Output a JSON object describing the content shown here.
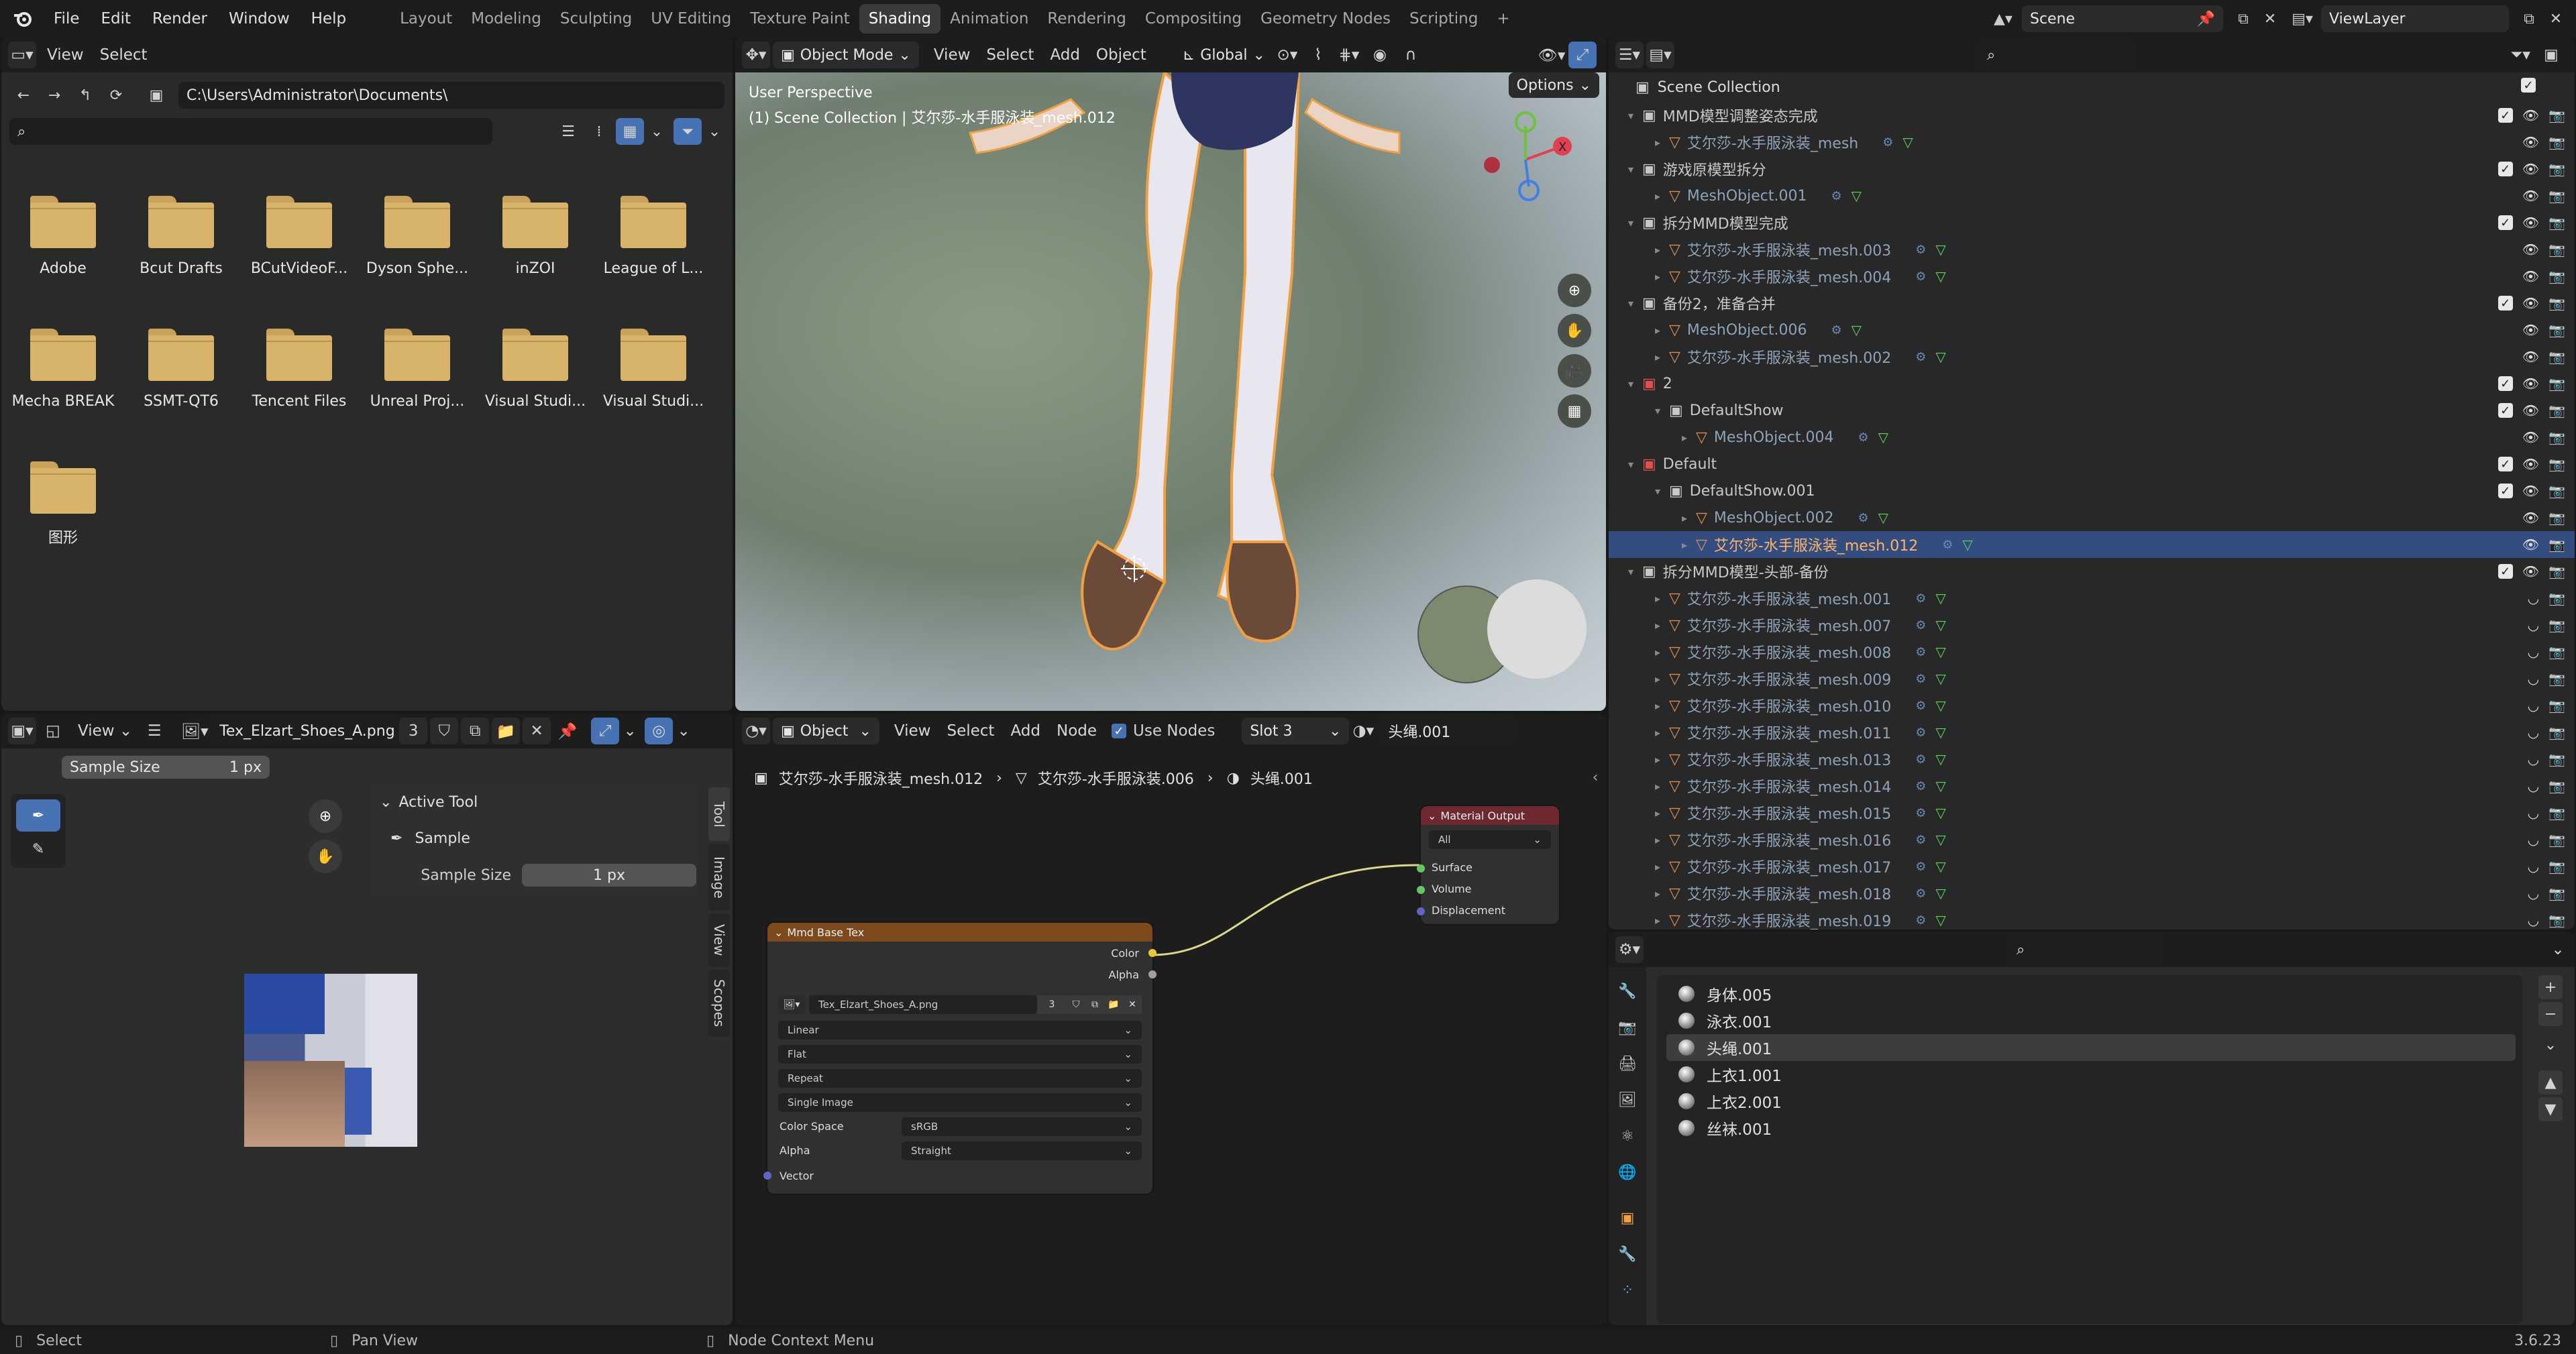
{
  "topbar": {
    "menus": [
      "File",
      "Edit",
      "Render",
      "Window",
      "Help"
    ],
    "workspaces": [
      "Layout",
      "Modeling",
      "Sculpting",
      "UV Editing",
      "Texture Paint",
      "Shading",
      "Animation",
      "Rendering",
      "Compositing",
      "Geometry Nodes",
      "Scripting"
    ],
    "active_workspace": "Shading",
    "add_tab": "+",
    "scene": "Scene",
    "viewlayer": "ViewLayer"
  },
  "filebrowser": {
    "menus": [
      "View",
      "Select"
    ],
    "path": "C:\\Users\\Administrator\\Documents\\",
    "search": "",
    "folders": [
      "Adobe",
      "Bcut Drafts",
      "BCutVideoF...",
      "Dyson Sphe...",
      "inZOI",
      "League of L...",
      "Mecha BREAK",
      "SSMT-QT6",
      "Tencent Files",
      "Unreal Proj...",
      "Visual Studi...",
      "Visual Studi...",
      "图形"
    ]
  },
  "viewport": {
    "mode": "Object Mode",
    "menus": [
      "View",
      "Select",
      "Add",
      "Object"
    ],
    "orientation": "Global",
    "options": "Options",
    "title": "User Perspective",
    "subtitle": "(1) Scene Collection | 艾尔莎-水手服泳装_mesh.012"
  },
  "imageeditor": {
    "view": "View",
    "image": "Tex_Elzart_Shoes_A.png",
    "users": "3",
    "sample_label": "Sample Size",
    "sample_value": "1 px",
    "active_tool": "Active Tool",
    "tool_name": "Sample",
    "tabs": [
      "Tool",
      "Image",
      "View",
      "Scopes"
    ]
  },
  "nodeeditor": {
    "type": "Object",
    "menus": [
      "View",
      "Select",
      "Add",
      "Node"
    ],
    "use_nodes": "Use Nodes",
    "slot": "Slot 3",
    "material": "头绳.001",
    "breadcrumb": [
      "艾尔莎-水手服泳装_mesh.012",
      "艾尔莎-水手服泳装.006",
      "头绳.001"
    ],
    "tex_node": {
      "title": "Mmd Base Tex",
      "out_color": "Color",
      "out_alpha": "Alpha",
      "image": "Tex_Elzart_Shoes_A.png",
      "users": "3",
      "interp": "Linear",
      "proj": "Flat",
      "ext": "Repeat",
      "source": "Single Image",
      "cs_label": "Color Space",
      "cs_value": "sRGB",
      "alpha_label": "Alpha",
      "alpha_value": "Straight",
      "vector": "Vector"
    },
    "out_node": {
      "title": "Material Output",
      "target": "All",
      "surface": "Surface",
      "volume": "Volume",
      "displacement": "Displacement"
    }
  },
  "outliner": {
    "root": "Scene Collection",
    "rows": [
      {
        "label": "MMD模型调整姿态完成",
        "level": 1,
        "kind": "coll"
      },
      {
        "label": "艾尔莎-水手服泳装_mesh",
        "level": 2,
        "kind": "mesh"
      },
      {
        "label": "游戏原模型拆分",
        "level": 1,
        "kind": "coll"
      },
      {
        "label": "MeshObject.001",
        "level": 2,
        "kind": "mesh"
      },
      {
        "label": "拆分MMD模型完成",
        "level": 1,
        "kind": "coll"
      },
      {
        "label": "艾尔莎-水手服泳装_mesh.003",
        "level": 2,
        "kind": "mesh"
      },
      {
        "label": "艾尔莎-水手服泳装_mesh.004",
        "level": 2,
        "kind": "mesh"
      },
      {
        "label": "备份2，准备合并",
        "level": 1,
        "kind": "coll"
      },
      {
        "label": "MeshObject.006",
        "level": 2,
        "kind": "mesh"
      },
      {
        "label": "艾尔莎-水手服泳装_mesh.002",
        "level": 2,
        "kind": "mesh"
      },
      {
        "label": "2",
        "level": 1,
        "kind": "collred"
      },
      {
        "label": "DefaultShow",
        "level": 2,
        "kind": "coll"
      },
      {
        "label": "MeshObject.004",
        "level": 3,
        "kind": "mesh"
      },
      {
        "label": "Default",
        "level": 1,
        "kind": "collred"
      },
      {
        "label": "DefaultShow.001",
        "level": 2,
        "kind": "coll"
      },
      {
        "label": "MeshObject.002",
        "level": 3,
        "kind": "mesh"
      },
      {
        "label": "艾尔莎-水手服泳装_mesh.012",
        "level": 3,
        "kind": "mesh",
        "selected": true
      },
      {
        "label": "拆分MMD模型-头部-备份",
        "level": 1,
        "kind": "coll"
      },
      {
        "label": "艾尔莎-水手服泳装_mesh.001",
        "level": 2,
        "kind": "mesh"
      },
      {
        "label": "艾尔莎-水手服泳装_mesh.007",
        "level": 2,
        "kind": "mesh"
      },
      {
        "label": "艾尔莎-水手服泳装_mesh.008",
        "level": 2,
        "kind": "mesh"
      },
      {
        "label": "艾尔莎-水手服泳装_mesh.009",
        "level": 2,
        "kind": "mesh"
      },
      {
        "label": "艾尔莎-水手服泳装_mesh.010",
        "level": 2,
        "kind": "mesh"
      },
      {
        "label": "艾尔莎-水手服泳装_mesh.011",
        "level": 2,
        "kind": "mesh"
      },
      {
        "label": "艾尔莎-水手服泳装_mesh.013",
        "level": 2,
        "kind": "mesh"
      },
      {
        "label": "艾尔莎-水手服泳装_mesh.014",
        "level": 2,
        "kind": "mesh"
      },
      {
        "label": "艾尔莎-水手服泳装_mesh.015",
        "level": 2,
        "kind": "mesh"
      },
      {
        "label": "艾尔莎-水手服泳装_mesh.016",
        "level": 2,
        "kind": "mesh"
      },
      {
        "label": "艾尔莎-水手服泳装_mesh.017",
        "level": 2,
        "kind": "mesh"
      },
      {
        "label": "艾尔莎-水手服泳装_mesh.018",
        "level": 2,
        "kind": "mesh"
      },
      {
        "label": "艾尔莎-水手服泳装_mesh.019",
        "level": 2,
        "kind": "mesh"
      }
    ]
  },
  "properties": {
    "materials": [
      "身体.005",
      "泳衣.001",
      "头绳.001",
      "上衣1.001",
      "上衣2.001",
      "丝袜.001"
    ],
    "active_material": "头绳.001"
  },
  "statusbar": {
    "select": "Select",
    "pan": "Pan View",
    "context": "Node Context Menu",
    "version": "3.6.23"
  }
}
